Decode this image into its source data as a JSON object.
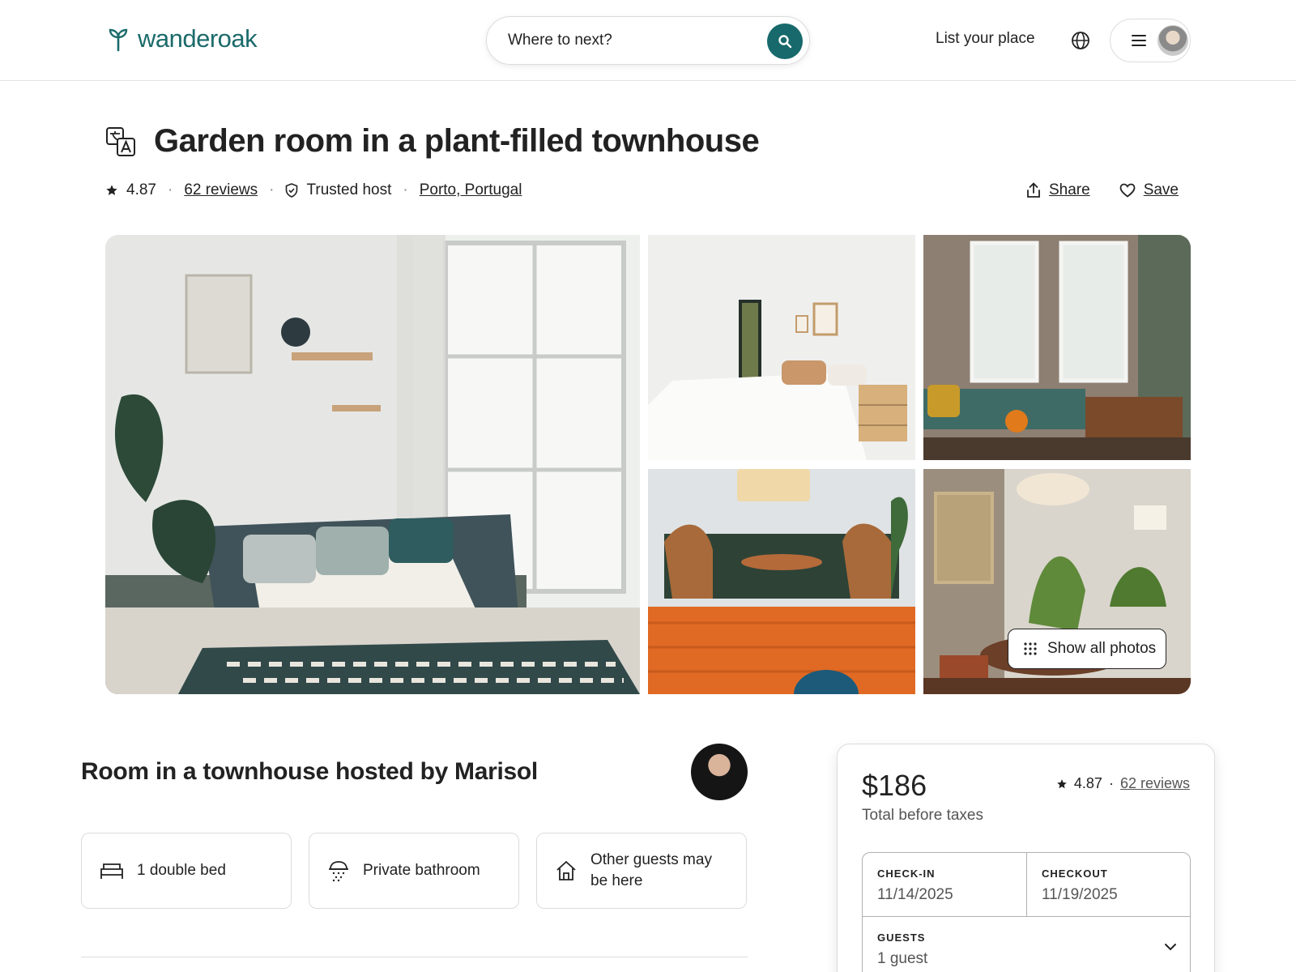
{
  "header": {
    "brand": "wanderoak",
    "search_placeholder": "Where to next?",
    "list_your_place": "List your place"
  },
  "listing": {
    "title": "Garden room in a plant-filled townhouse",
    "rating": "4.87",
    "reviews": "62 reviews",
    "host_badge": "Trusted host",
    "location": "Porto, Portugal",
    "share": "Share",
    "save": "Save",
    "show_all_photos": "Show all photos"
  },
  "host": {
    "heading": "Room in a townhouse hosted by Marisol"
  },
  "features": [
    {
      "label": "1 double bed",
      "icon": "bed-icon"
    },
    {
      "label": "Private bathroom",
      "icon": "shower-icon"
    },
    {
      "label": "Other guests may be here",
      "icon": "house-icon"
    }
  ],
  "booking": {
    "price": "$186",
    "price_note": "Total before taxes",
    "rating": "4.87",
    "reviews": "62 reviews",
    "checkin_label": "CHECK-IN",
    "checkin_value": "11/14/2025",
    "checkout_label": "CHECKOUT",
    "checkout_value": "11/19/2025",
    "guests_label": "GUESTS",
    "guests_value": "1 guest"
  },
  "colors": {
    "brand": "#1c6b6b",
    "search_button": "#17696b"
  }
}
